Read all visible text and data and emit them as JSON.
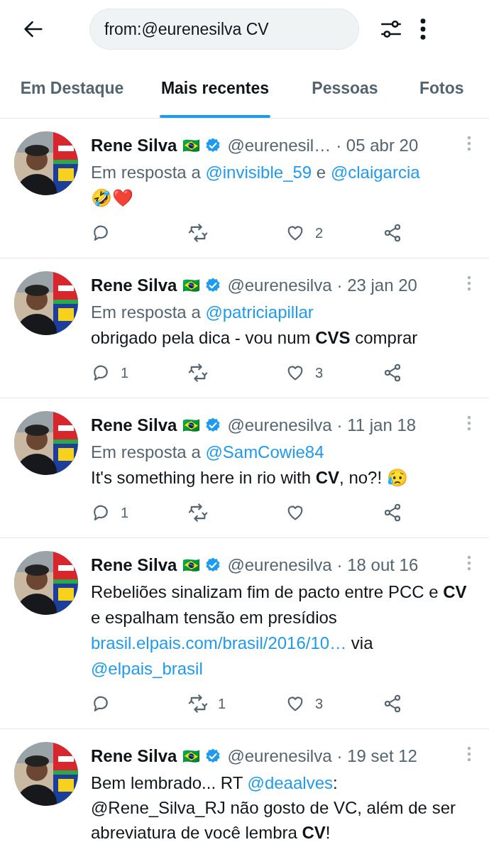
{
  "search": {
    "value": "from:@eurenesilva CV"
  },
  "tabs": [
    {
      "label": "Em Destaque",
      "selected": false
    },
    {
      "label": "Mais recentes",
      "selected": true
    },
    {
      "label": "Pessoas",
      "selected": false
    },
    {
      "label": "Fotos",
      "selected": false
    }
  ],
  "tweets": [
    {
      "name": "Rene Silva",
      "flag": "🇧🇷",
      "verified": true,
      "handle": "@eurenesil…",
      "date": "· 05 abr 20",
      "reply_to": [
        {
          "kind": "text",
          "text": "Em resposta a "
        },
        {
          "kind": "link",
          "text": "@invisible_59"
        },
        {
          "kind": "text",
          "text": " e "
        },
        {
          "kind": "link",
          "text": "@claigarcia"
        }
      ],
      "body": [
        {
          "kind": "text",
          "text": "🤣❤️"
        }
      ],
      "likes": "2"
    },
    {
      "name": "Rene Silva",
      "flag": "🇧🇷",
      "verified": true,
      "handle": "@eurenesilva",
      "date": "· 23 jan 20",
      "reply_to": [
        {
          "kind": "text",
          "text": "Em resposta a "
        },
        {
          "kind": "link",
          "text": "@patriciapillar"
        }
      ],
      "body": [
        {
          "kind": "text",
          "text": "obrigado pela dica - vou num **CVS** comprar"
        }
      ],
      "replies": "1",
      "likes": "3"
    },
    {
      "name": "Rene Silva",
      "flag": "🇧🇷",
      "verified": true,
      "handle": "@eurenesilva",
      "date": "· 11 jan 18",
      "reply_to": [
        {
          "kind": "text",
          "text": "Em resposta a "
        },
        {
          "kind": "link",
          "text": "@SamCowie84"
        }
      ],
      "body": [
        {
          "kind": "text",
          "text": "It's something here in rio with **CV**, no?! 😥"
        }
      ],
      "replies": "1"
    },
    {
      "name": "Rene Silva",
      "flag": "🇧🇷",
      "verified": true,
      "handle": "@eurenesilva",
      "date": "· 18 out 16",
      "body": [
        {
          "kind": "text",
          "text": "Rebeliões sinalizam fim de pacto entre PCC e **CV** e espalham tensão em presídios "
        },
        {
          "kind": "link",
          "text": "brasil.elpais.com/brasil/2016/10…"
        },
        {
          "kind": "text",
          "text": " via "
        },
        {
          "kind": "link",
          "text": "@elpais_brasil"
        }
      ],
      "retweets": "1",
      "likes": "3"
    },
    {
      "name": "Rene Silva",
      "flag": "🇧🇷",
      "verified": true,
      "handle": "@eurenesilva",
      "date": "· 19 set 12",
      "body": [
        {
          "kind": "text",
          "text": "Bem lembrado... RT "
        },
        {
          "kind": "link",
          "text": "@deaalves"
        },
        {
          "kind": "text",
          "text": ": @Rene_Silva_RJ não gosto de VC, além de ser abreviatura de você lembra **CV**!"
        }
      ]
    }
  ]
}
